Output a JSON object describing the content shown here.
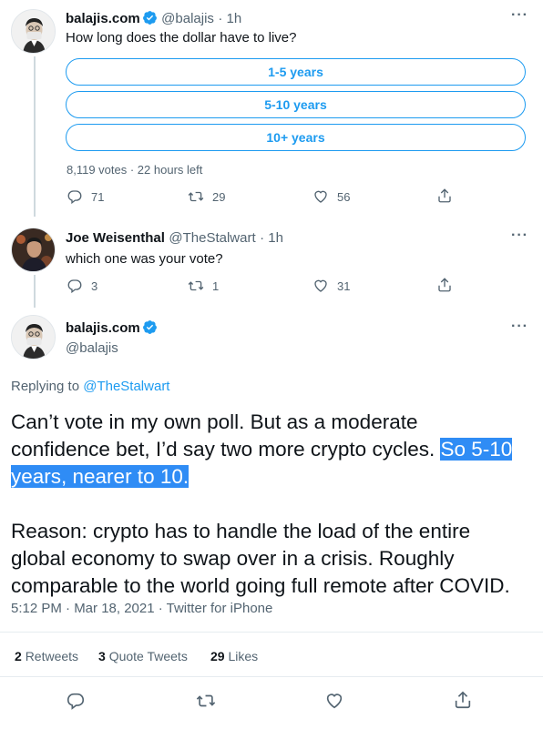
{
  "tweet1": {
    "name": "balajis.com",
    "handle": "@balajis",
    "time": "· 1h",
    "text": "How long does the dollar have to live?",
    "poll_options": [
      "1-5 years",
      "5-10 years",
      "10+ years"
    ],
    "poll_meta": "8,119 votes · 22 hours left",
    "replies": "71",
    "retweets": "29",
    "likes": "56"
  },
  "tweet2": {
    "name": "Joe Weisenthal",
    "handle": "@TheStalwart",
    "time": "· 1h",
    "text": "which one was your vote?",
    "replies": "3",
    "retweets": "1",
    "likes": "31"
  },
  "main": {
    "name": "balajis.com",
    "handle": "@balajis",
    "replying_prefix": "Replying to ",
    "replying_to": "@TheStalwart",
    "line1a": "Can’t vote in my own poll. But as a moderate",
    "line1b": "confidence bet, I’d say two more crypto cycles. ",
    "line1b_hl": "So 5-10",
    "line1c_hl": "years, nearer to 10.",
    "para2_l1": "Reason: crypto has to handle the load of the entire",
    "para2_l2": "global economy to swap over in a crisis. Roughly",
    "para2_l3": "comparable to the world going full remote after COVID.",
    "timestamp": "5:12 PM · Mar 18, 2021 · Twitter for iPhone",
    "retweets_count": "2",
    "retweets_label": "Retweets",
    "quotes_count": "3",
    "quotes_label": "Quote Tweets",
    "likes_count": "29",
    "likes_label": "Likes"
  },
  "more_label": "···",
  "colors": {
    "accent": "#1d9bf0",
    "muted": "#536471",
    "highlight": "#2f8cf5"
  }
}
